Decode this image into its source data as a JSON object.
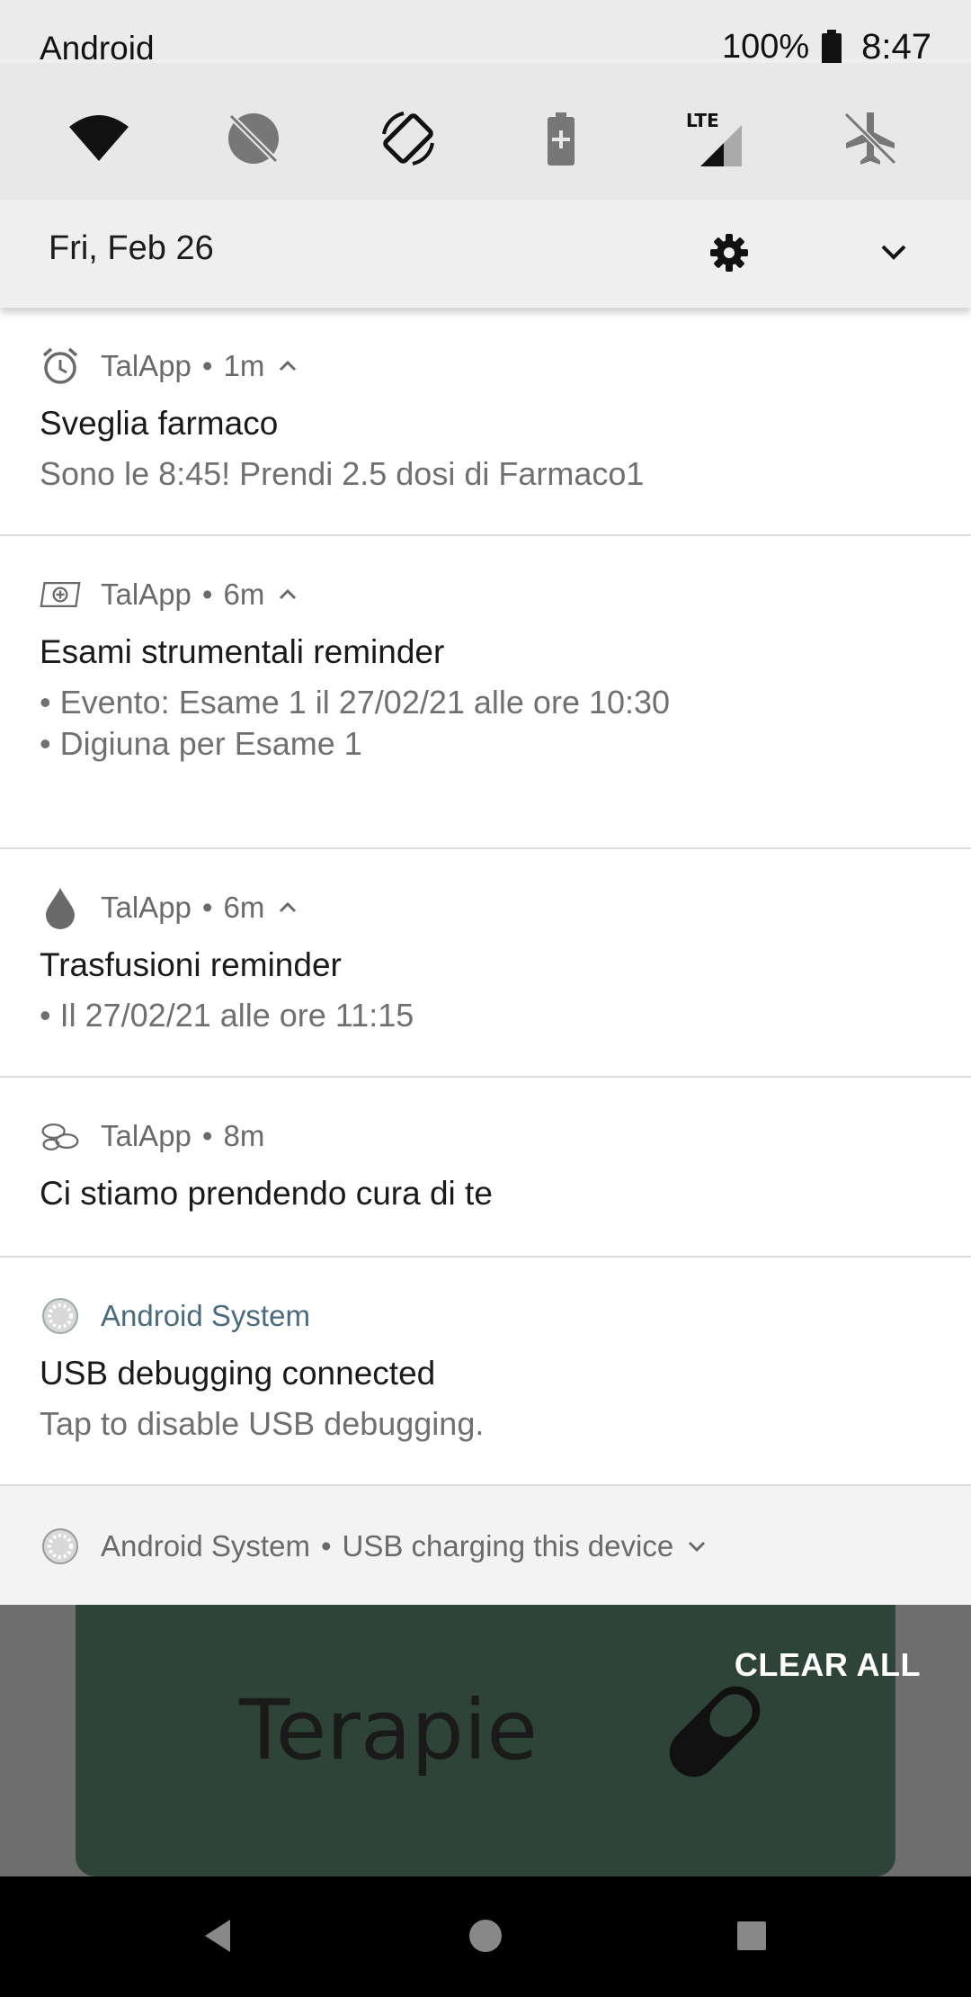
{
  "status_bar": {
    "carrier": "Android",
    "battery_percent": "100%",
    "time": "8:47"
  },
  "quick_settings": {
    "tiles": [
      "wifi-icon",
      "data-saver-off-icon",
      "auto-rotate-icon",
      "battery-saver-icon",
      "mobile-data-lte-icon",
      "airplane-mode-off-icon"
    ],
    "date": "Fri, Feb 26"
  },
  "notifications": [
    {
      "app": "TalApp",
      "time": "1m",
      "icon": "alarm-clock-icon",
      "title": "Sveglia farmaco",
      "lines": [
        "Sono le 8:45! Prendi 2.5 dosi di Farmaco1"
      ]
    },
    {
      "app": "TalApp",
      "time": "6m",
      "icon": "medical-card-icon",
      "title": "Esami strumentali reminder",
      "lines": [
        "• Evento: Esame 1 il 27/02/21 alle ore 10:30",
        "• Digiuna per Esame 1"
      ]
    },
    {
      "app": "TalApp",
      "time": "6m",
      "icon": "blood-drop-icon",
      "title": "Trasfusioni reminder",
      "lines": [
        "• Il 27/02/21 alle ore 11:15"
      ]
    },
    {
      "app": "TalApp",
      "time": "8m",
      "icon": "pills-icon",
      "title": "Ci stiamo prendendo cura di te",
      "lines": []
    },
    {
      "app": "Android System",
      "time": "",
      "icon": "android-system-icon",
      "title": "USB debugging connected",
      "lines": [
        "Tap to disable USB debugging."
      ]
    }
  ],
  "collapsed_notification": {
    "app": "Android System",
    "text": "USB charging this device"
  },
  "separator": "•",
  "background_app": {
    "card_title": "Terapie",
    "clear_all": "CLEAR ALL"
  },
  "colors": {
    "card_bg": "#2f4439",
    "system_app_name": "#4a6b7d"
  }
}
